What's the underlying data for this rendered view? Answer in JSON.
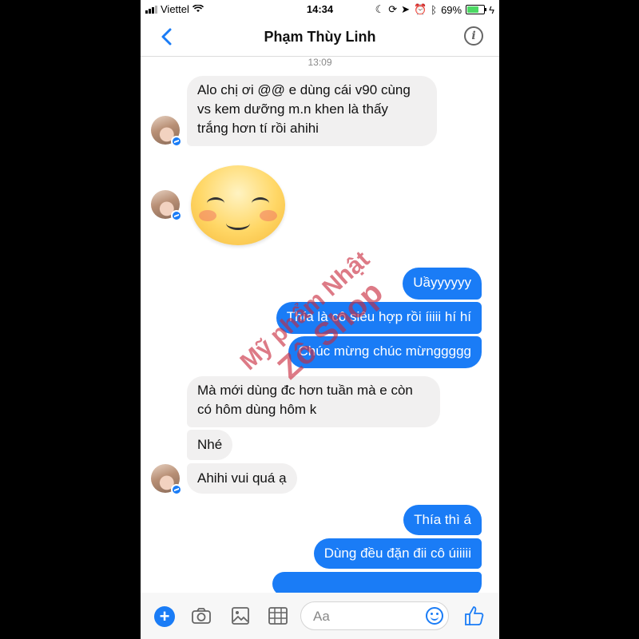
{
  "status_bar": {
    "carrier": "Viettel",
    "time": "14:34",
    "battery": "69%"
  },
  "header": {
    "title": "Phạm Thùy Linh",
    "back_icon": "chevron-left-icon",
    "info_icon": "info-icon"
  },
  "timestamp": "13:09",
  "messages": [
    {
      "side": "in",
      "lines": [
        "Alo chị ơi @@ e dùng cái v90 cùng",
        "vs kem dưỡng m.n khen là thấy",
        "trắng hơn tí rồi ahihi"
      ]
    },
    {
      "side": "in",
      "sticker": "blushing-smile-sticker"
    },
    {
      "side": "out",
      "text": "Uầyyyyyy"
    },
    {
      "side": "out",
      "text": "Thía là cô siêu hợp rồi íiiii hí hí"
    },
    {
      "side": "out",
      "text": "Chúc mừng chúc mừnggggg"
    },
    {
      "side": "in",
      "lines": [
        "Mà mới dùng đc hơn tuần mà e còn",
        "có hôm dùng hôm k"
      ]
    },
    {
      "side": "in",
      "text": "Nhé"
    },
    {
      "side": "in",
      "text": "Ahihi vui quá ạ"
    },
    {
      "side": "out",
      "text": "Thía thì á"
    },
    {
      "side": "out",
      "text": "Dùng đều đặn đii cô úiiiii"
    }
  ],
  "watermark": {
    "line1": "Mỹ phẩm Nhật",
    "line2": "Zô Shop"
  },
  "composer": {
    "placeholder": "Aa"
  },
  "colors": {
    "accent": "#1a7cf6",
    "incoming_bubble": "#f1f0f0"
  }
}
